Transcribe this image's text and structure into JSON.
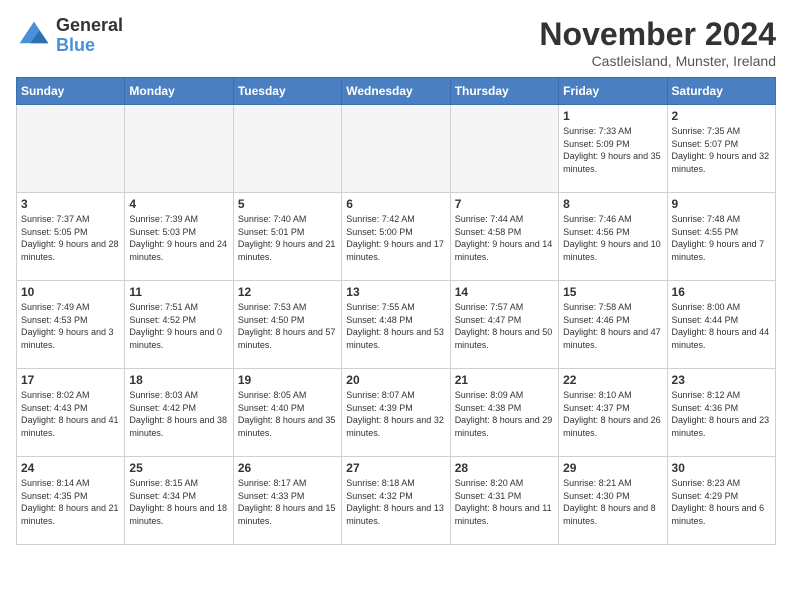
{
  "logo": {
    "general": "General",
    "blue": "Blue"
  },
  "title": "November 2024",
  "location": "Castleisland, Munster, Ireland",
  "days_header": [
    "Sunday",
    "Monday",
    "Tuesday",
    "Wednesday",
    "Thursday",
    "Friday",
    "Saturday"
  ],
  "weeks": [
    [
      {
        "day": "",
        "sunrise": "",
        "sunset": "",
        "daylight": ""
      },
      {
        "day": "",
        "sunrise": "",
        "sunset": "",
        "daylight": ""
      },
      {
        "day": "",
        "sunrise": "",
        "sunset": "",
        "daylight": ""
      },
      {
        "day": "",
        "sunrise": "",
        "sunset": "",
        "daylight": ""
      },
      {
        "day": "",
        "sunrise": "",
        "sunset": "",
        "daylight": ""
      },
      {
        "day": "1",
        "sunrise": "Sunrise: 7:33 AM",
        "sunset": "Sunset: 5:09 PM",
        "daylight": "Daylight: 9 hours and 35 minutes."
      },
      {
        "day": "2",
        "sunrise": "Sunrise: 7:35 AM",
        "sunset": "Sunset: 5:07 PM",
        "daylight": "Daylight: 9 hours and 32 minutes."
      }
    ],
    [
      {
        "day": "3",
        "sunrise": "Sunrise: 7:37 AM",
        "sunset": "Sunset: 5:05 PM",
        "daylight": "Daylight: 9 hours and 28 minutes."
      },
      {
        "day": "4",
        "sunrise": "Sunrise: 7:39 AM",
        "sunset": "Sunset: 5:03 PM",
        "daylight": "Daylight: 9 hours and 24 minutes."
      },
      {
        "day": "5",
        "sunrise": "Sunrise: 7:40 AM",
        "sunset": "Sunset: 5:01 PM",
        "daylight": "Daylight: 9 hours and 21 minutes."
      },
      {
        "day": "6",
        "sunrise": "Sunrise: 7:42 AM",
        "sunset": "Sunset: 5:00 PM",
        "daylight": "Daylight: 9 hours and 17 minutes."
      },
      {
        "day": "7",
        "sunrise": "Sunrise: 7:44 AM",
        "sunset": "Sunset: 4:58 PM",
        "daylight": "Daylight: 9 hours and 14 minutes."
      },
      {
        "day": "8",
        "sunrise": "Sunrise: 7:46 AM",
        "sunset": "Sunset: 4:56 PM",
        "daylight": "Daylight: 9 hours and 10 minutes."
      },
      {
        "day": "9",
        "sunrise": "Sunrise: 7:48 AM",
        "sunset": "Sunset: 4:55 PM",
        "daylight": "Daylight: 9 hours and 7 minutes."
      }
    ],
    [
      {
        "day": "10",
        "sunrise": "Sunrise: 7:49 AM",
        "sunset": "Sunset: 4:53 PM",
        "daylight": "Daylight: 9 hours and 3 minutes."
      },
      {
        "day": "11",
        "sunrise": "Sunrise: 7:51 AM",
        "sunset": "Sunset: 4:52 PM",
        "daylight": "Daylight: 9 hours and 0 minutes."
      },
      {
        "day": "12",
        "sunrise": "Sunrise: 7:53 AM",
        "sunset": "Sunset: 4:50 PM",
        "daylight": "Daylight: 8 hours and 57 minutes."
      },
      {
        "day": "13",
        "sunrise": "Sunrise: 7:55 AM",
        "sunset": "Sunset: 4:48 PM",
        "daylight": "Daylight: 8 hours and 53 minutes."
      },
      {
        "day": "14",
        "sunrise": "Sunrise: 7:57 AM",
        "sunset": "Sunset: 4:47 PM",
        "daylight": "Daylight: 8 hours and 50 minutes."
      },
      {
        "day": "15",
        "sunrise": "Sunrise: 7:58 AM",
        "sunset": "Sunset: 4:46 PM",
        "daylight": "Daylight: 8 hours and 47 minutes."
      },
      {
        "day": "16",
        "sunrise": "Sunrise: 8:00 AM",
        "sunset": "Sunset: 4:44 PM",
        "daylight": "Daylight: 8 hours and 44 minutes."
      }
    ],
    [
      {
        "day": "17",
        "sunrise": "Sunrise: 8:02 AM",
        "sunset": "Sunset: 4:43 PM",
        "daylight": "Daylight: 8 hours and 41 minutes."
      },
      {
        "day": "18",
        "sunrise": "Sunrise: 8:03 AM",
        "sunset": "Sunset: 4:42 PM",
        "daylight": "Daylight: 8 hours and 38 minutes."
      },
      {
        "day": "19",
        "sunrise": "Sunrise: 8:05 AM",
        "sunset": "Sunset: 4:40 PM",
        "daylight": "Daylight: 8 hours and 35 minutes."
      },
      {
        "day": "20",
        "sunrise": "Sunrise: 8:07 AM",
        "sunset": "Sunset: 4:39 PM",
        "daylight": "Daylight: 8 hours and 32 minutes."
      },
      {
        "day": "21",
        "sunrise": "Sunrise: 8:09 AM",
        "sunset": "Sunset: 4:38 PM",
        "daylight": "Daylight: 8 hours and 29 minutes."
      },
      {
        "day": "22",
        "sunrise": "Sunrise: 8:10 AM",
        "sunset": "Sunset: 4:37 PM",
        "daylight": "Daylight: 8 hours and 26 minutes."
      },
      {
        "day": "23",
        "sunrise": "Sunrise: 8:12 AM",
        "sunset": "Sunset: 4:36 PM",
        "daylight": "Daylight: 8 hours and 23 minutes."
      }
    ],
    [
      {
        "day": "24",
        "sunrise": "Sunrise: 8:14 AM",
        "sunset": "Sunset: 4:35 PM",
        "daylight": "Daylight: 8 hours and 21 minutes."
      },
      {
        "day": "25",
        "sunrise": "Sunrise: 8:15 AM",
        "sunset": "Sunset: 4:34 PM",
        "daylight": "Daylight: 8 hours and 18 minutes."
      },
      {
        "day": "26",
        "sunrise": "Sunrise: 8:17 AM",
        "sunset": "Sunset: 4:33 PM",
        "daylight": "Daylight: 8 hours and 15 minutes."
      },
      {
        "day": "27",
        "sunrise": "Sunrise: 8:18 AM",
        "sunset": "Sunset: 4:32 PM",
        "daylight": "Daylight: 8 hours and 13 minutes."
      },
      {
        "day": "28",
        "sunrise": "Sunrise: 8:20 AM",
        "sunset": "Sunset: 4:31 PM",
        "daylight": "Daylight: 8 hours and 11 minutes."
      },
      {
        "day": "29",
        "sunrise": "Sunrise: 8:21 AM",
        "sunset": "Sunset: 4:30 PM",
        "daylight": "Daylight: 8 hours and 8 minutes."
      },
      {
        "day": "30",
        "sunrise": "Sunrise: 8:23 AM",
        "sunset": "Sunset: 4:29 PM",
        "daylight": "Daylight: 8 hours and 6 minutes."
      }
    ]
  ]
}
